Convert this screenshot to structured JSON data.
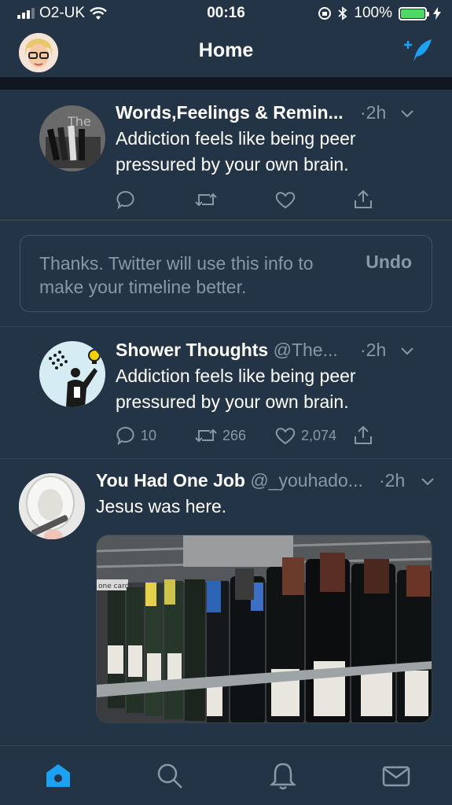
{
  "status": {
    "carrier": "O2-UK",
    "time": "00:16",
    "battery": "100%",
    "battery_level": 1.0
  },
  "nav": {
    "title": "Home",
    "compose_icon": "compose-tweet-icon"
  },
  "tweets": [
    {
      "name": "Words,Feelings & Remin...",
      "handle": "",
      "time": "·2h",
      "text_line1": "Addiction feels like being peer",
      "text_line2": "pressured by your own brain.",
      "replies": "",
      "retweets": "",
      "likes": ""
    },
    {
      "name": "Shower Thoughts",
      "handle": "@The...",
      "time": "·2h",
      "text_line1": "Addiction feels like being peer",
      "text_line2": "pressured by your own brain.",
      "replies": "10",
      "retweets": "266",
      "likes": "2,074"
    },
    {
      "name": "You Had One Job",
      "handle": "@_youhado...",
      "time": "·2h",
      "text_line1": "Jesus was here.",
      "media_sign_text": "one cards"
    }
  ],
  "feedback": {
    "message": "Thanks. Twitter will use this info to make your timeline better.",
    "undo": "Undo"
  },
  "tabs": [
    "home-icon",
    "search-icon",
    "notifications-icon",
    "messages-icon"
  ],
  "colors": {
    "accent": "#1da1f2",
    "background": "#243447",
    "muted": "#8899a6"
  }
}
